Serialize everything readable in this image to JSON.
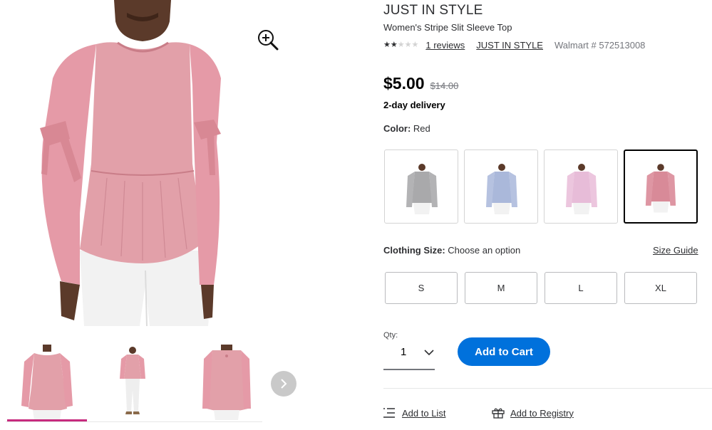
{
  "product": {
    "brand": "JUST IN STYLE",
    "title": "Women's Stripe Slit Sleeve Top",
    "rating": {
      "value": 2,
      "max": 5
    },
    "reviews_link": "1 reviews",
    "brand_link": "JUST IN STYLE",
    "walmart_number": "Walmart # 572513008"
  },
  "pricing": {
    "current": "$5.00",
    "was": "$14.00",
    "delivery": "2-day delivery"
  },
  "color": {
    "label": "Color:",
    "selected": "Red",
    "swatches": [
      {
        "name": "Gray",
        "shirt": "#a9a9ab"
      },
      {
        "name": "Blue",
        "shirt": "#aab8da"
      },
      {
        "name": "Pink",
        "shirt": "#e7bcd8"
      },
      {
        "name": "Red",
        "shirt": "#d88a98"
      }
    ]
  },
  "size": {
    "label": "Clothing Size:",
    "prompt": "Choose an option",
    "guide_link": "Size Guide",
    "options": [
      "S",
      "M",
      "L",
      "XL"
    ]
  },
  "quantity": {
    "label": "Qty:",
    "value": "1"
  },
  "cart": {
    "button": "Add to Cart"
  },
  "actions": {
    "add_to_list": "Add to List",
    "add_to_registry": "Add to Registry"
  },
  "colors": {
    "primary_blue": "#0071dc",
    "active_thumb": "#c72b7e",
    "shirt_main": "#e2a0a9"
  }
}
